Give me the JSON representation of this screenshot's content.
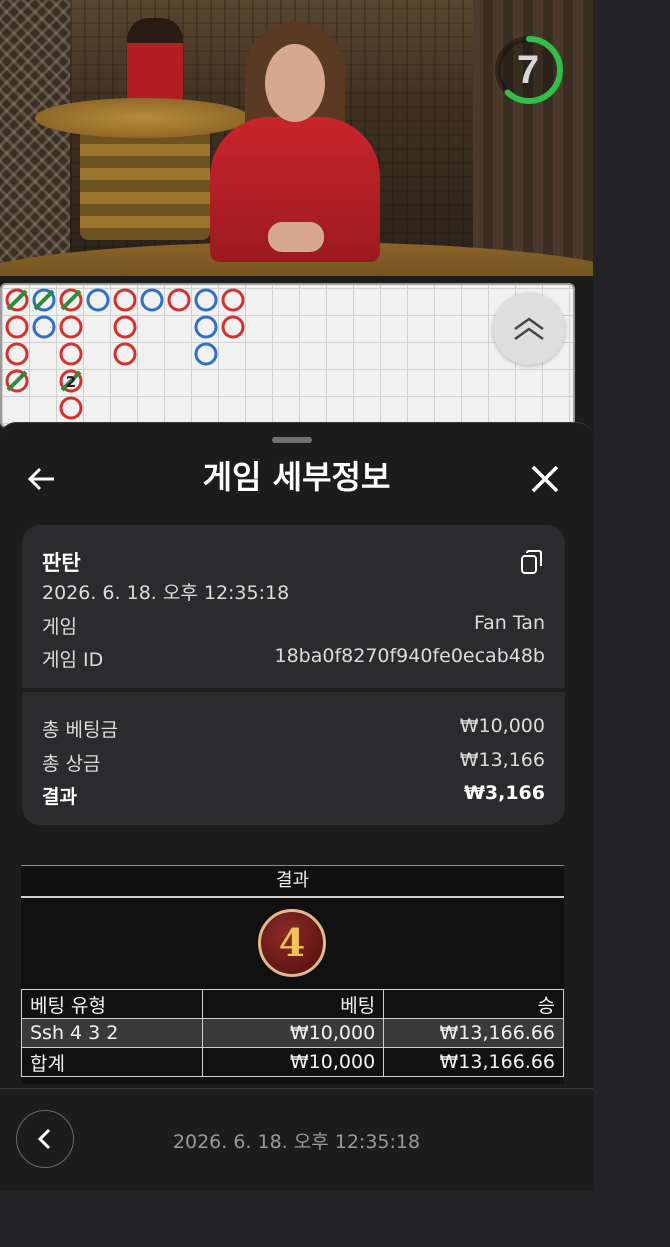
{
  "video": {
    "countdown": "7",
    "countdown_fraction": 0.62
  },
  "roadmap": {
    "columns": [
      [
        "red-slash",
        "red",
        "red",
        "red-slash"
      ],
      [
        "blue-slash",
        "blue"
      ],
      [
        "red-slash",
        "red",
        "red",
        "red-slash-2",
        "red"
      ],
      [
        "blue"
      ],
      [
        "red",
        "red",
        "red"
      ],
      [
        "blue"
      ],
      [
        "red"
      ],
      [
        "blue",
        "blue",
        "blue"
      ],
      [
        "red",
        "red"
      ]
    ],
    "tie_label": "2"
  },
  "header": {
    "title": "게임 세부정보"
  },
  "details": {
    "game_title": "판탄",
    "datetime": "2026. 6. 18. 오후 12:35:18",
    "game_label": "게임",
    "game_value": "Fan Tan",
    "game_id_label": "게임 ID",
    "game_id_value": "18ba0f8270f940fe0ecab48b",
    "total_bet_label": "총 베팅금",
    "total_bet_value": "₩10,000",
    "total_win_label": "총 상금",
    "total_win_value": "₩13,166",
    "result_label": "결과",
    "result_value": "₩3,166"
  },
  "results": {
    "header": "결과",
    "outcome": "4",
    "columns": [
      "베팅 유형",
      "베팅",
      "승"
    ],
    "rows": [
      {
        "type": "Ssh 4 3 2",
        "bet": "₩10,000",
        "win": "₩13,166.66"
      }
    ],
    "total": {
      "type": "합계",
      "bet": "₩10,000",
      "win": "₩13,166.66"
    }
  },
  "footer": {
    "datetime": "2026. 6. 18. 오후 12:35:18"
  },
  "colors": {
    "timer_green": "#2fbf4a",
    "road_red": "#d2322d",
    "road_blue": "#2f6fc6",
    "road_slash": "#2e8b3a"
  }
}
